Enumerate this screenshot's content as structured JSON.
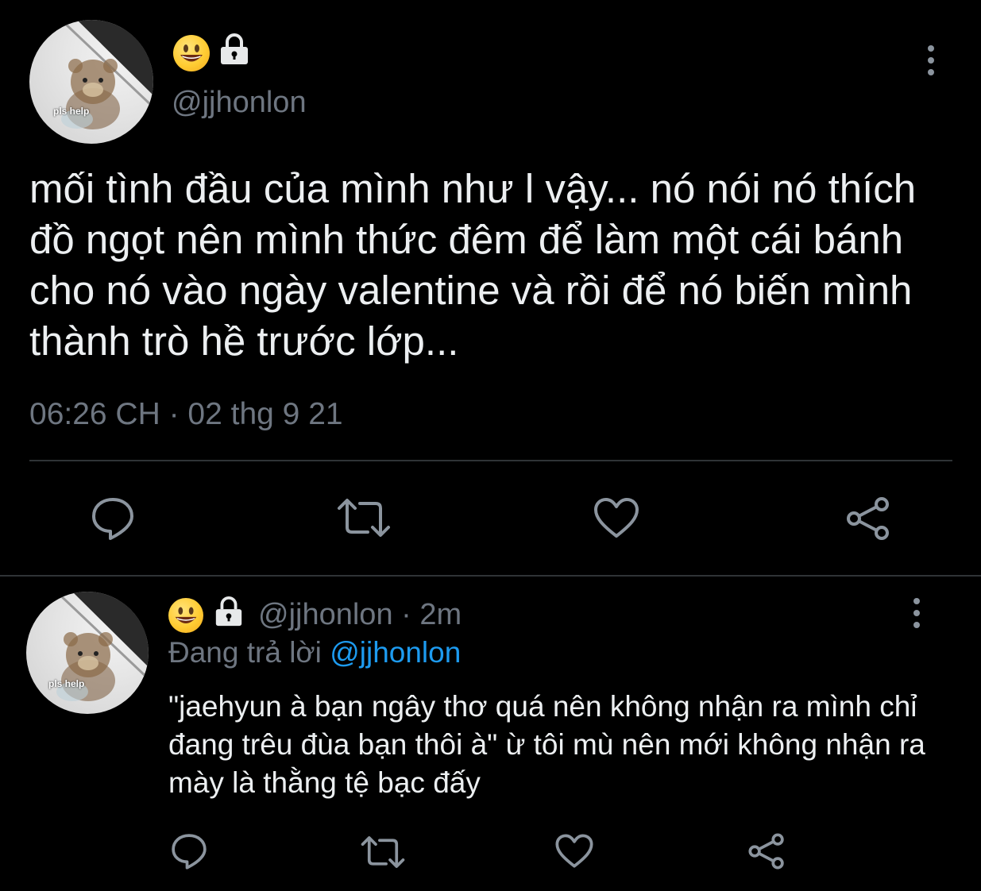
{
  "main_tweet": {
    "avatar_text": "pls help",
    "display_name_icons": [
      "smiley-emoji-icon",
      "lock-icon"
    ],
    "handle": "@jjhonlon",
    "text": "mối tình đầu của mình như l vậy... nó nói nó thích đồ ngọt nên mình thức đêm để làm một cái bánh cho nó vào ngày valentine và rồi để nó biến mình thành trò hề trước lớp...",
    "timestamp": "06:26 CH · 02 thg 9 21",
    "actions": [
      "reply-icon",
      "retweet-icon",
      "like-icon",
      "share-icon"
    ]
  },
  "reply_tweet": {
    "avatar_text": "pls help",
    "display_name_icons": [
      "smiley-emoji-icon",
      "lock-icon"
    ],
    "handle": "@jjhonlon",
    "time": "2m",
    "replying_prefix": "Đang trả lời ",
    "replying_mention": "@jjhonlon",
    "text": "\"jaehyun à bạn ngây thơ quá nên không nhận ra mình chỉ đang trêu đùa bạn thôi à\" ừ tôi mù nên mới không nhận ra mày là thằng tệ bạc đấy",
    "actions": [
      "reply-icon",
      "retweet-icon",
      "like-icon",
      "share-icon"
    ]
  },
  "colors": {
    "background": "#000000",
    "text": "#eceff1",
    "muted": "#6e7681",
    "link": "#1d9bf0",
    "divider": "#2f3336"
  }
}
